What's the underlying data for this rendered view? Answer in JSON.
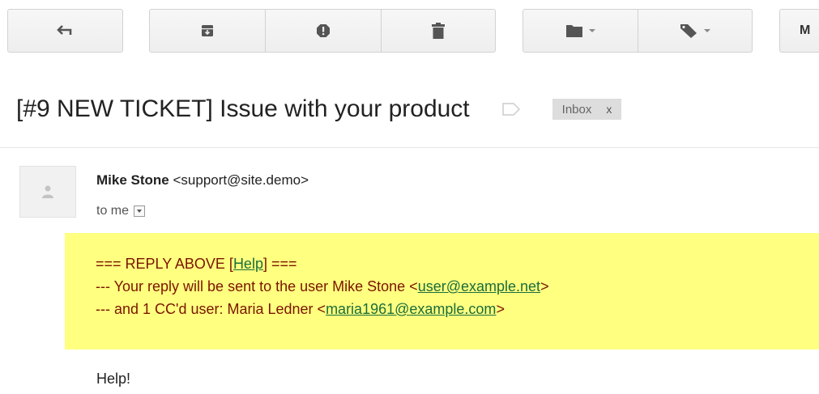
{
  "toolbar": {
    "back_icon": "reply-arrow-icon",
    "archive_icon": "archive-icon",
    "spam_icon": "report-spam-icon",
    "delete_icon": "trash-icon",
    "move_icon": "folder-icon",
    "labels_icon": "label-tag-icon",
    "more_label": "M"
  },
  "subject": {
    "title": "[#9 NEW TICKET] Issue with your product",
    "inbox_chip_label": "Inbox",
    "inbox_chip_remove": "x"
  },
  "message": {
    "sender_name": "Mike Stone",
    "sender_email": "<support@site.demo>",
    "recipient": "to me",
    "reply_block": {
      "line1_prefix": "=== REPLY ABOVE [",
      "help_link": "Help",
      "line1_suffix": "] ===",
      "line2_prefix": "--- Your reply will be sent to the user Mike Stone <",
      "line2_email": "user@example.net",
      "line2_suffix": ">",
      "line3_prefix": "--- and 1 CC'd user: Maria Ledner <",
      "line3_email": "maria1961@example.com",
      "line3_suffix": ">"
    },
    "body": "Help!"
  },
  "colors": {
    "reply_block_bg": "#ffff80",
    "reply_text": "#7a1500",
    "link": "#1a6d3a",
    "chip_bg": "#dddddd"
  }
}
